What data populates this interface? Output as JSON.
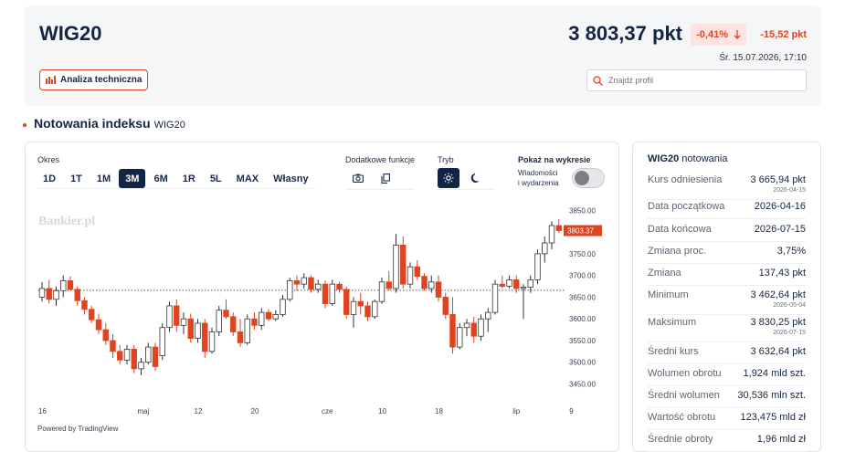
{
  "header": {
    "title": "WIG20",
    "price": "3 803,37 pkt",
    "change_pct": "-0,41%",
    "change_abs": "-15,52 pkt",
    "date": "Śr. 15.07.2026, 17:10",
    "ta_button": "Analiza techniczna",
    "search_placeholder": "Znajdź profil"
  },
  "section": {
    "title": "Notowania indeksu",
    "subtitle": "WIG20"
  },
  "controls": {
    "period_label": "Okres",
    "periods": [
      "1D",
      "1T",
      "1M",
      "3M",
      "6M",
      "1R",
      "5L",
      "MAX",
      "Własny"
    ],
    "active_period": "3M",
    "extra_label": "Dodatkowe funkcje",
    "mode_label": "Tryb",
    "show_label": "Pokaż na wykresie",
    "news_label_1": "Wiadomości",
    "news_label_2": "i wydarzenia"
  },
  "chart_data": {
    "type": "candlestick",
    "watermark": "Bankier.pl",
    "powered_by": "Powered by TradingView",
    "up_color": "#ffffff",
    "down_color": "#e0431f",
    "last_value_label": "3803.37",
    "reference_level": 3665.94,
    "ylim": [
      3430,
      3855
    ],
    "y_ticks": [
      "3850.00",
      "3800.00",
      "3750.00",
      "3700.00",
      "3650.00",
      "3600.00",
      "3550.00",
      "3500.00",
      "3450.00"
    ],
    "y_tick_values": [
      3850,
      3800,
      3750,
      3700,
      3650,
      3600,
      3550,
      3500,
      3450
    ],
    "x_ticks": [
      "16",
      "maj",
      "12",
      "20",
      "cze",
      "10",
      "18",
      "lip",
      "9"
    ],
    "x_tick_index": [
      0,
      14,
      22,
      30,
      40,
      48,
      56,
      67,
      75
    ],
    "candles": [
      [
        3650,
        3685,
        3640,
        3670
      ],
      [
        3670,
        3690,
        3635,
        3645
      ],
      [
        3645,
        3675,
        3630,
        3665
      ],
      [
        3665,
        3700,
        3650,
        3688
      ],
      [
        3688,
        3698,
        3665,
        3668
      ],
      [
        3668,
        3675,
        3630,
        3642
      ],
      [
        3642,
        3650,
        3610,
        3622
      ],
      [
        3622,
        3630,
        3590,
        3598
      ],
      [
        3598,
        3612,
        3565,
        3575
      ],
      [
        3575,
        3590,
        3540,
        3550
      ],
      [
        3550,
        3565,
        3510,
        3525
      ],
      [
        3525,
        3540,
        3495,
        3505
      ],
      [
        3505,
        3540,
        3495,
        3530
      ],
      [
        3530,
        3540,
        3475,
        3485
      ],
      [
        3485,
        3510,
        3470,
        3500
      ],
      [
        3500,
        3545,
        3495,
        3535
      ],
      [
        3535,
        3545,
        3480,
        3490
      ],
      [
        3515,
        3590,
        3505,
        3580
      ],
      [
        3580,
        3640,
        3570,
        3630
      ],
      [
        3630,
        3645,
        3570,
        3585
      ],
      [
        3585,
        3615,
        3565,
        3600
      ],
      [
        3600,
        3612,
        3545,
        3555
      ],
      [
        3555,
        3600,
        3545,
        3590
      ],
      [
        3590,
        3600,
        3510,
        3525
      ],
      [
        3525,
        3580,
        3520,
        3570
      ],
      [
        3570,
        3630,
        3560,
        3620
      ],
      [
        3620,
        3645,
        3600,
        3605
      ],
      [
        3605,
        3615,
        3560,
        3570
      ],
      [
        3570,
        3600,
        3535,
        3545
      ],
      [
        3545,
        3610,
        3540,
        3600
      ],
      [
        3600,
        3615,
        3575,
        3585
      ],
      [
        3585,
        3625,
        3575,
        3615
      ],
      [
        3615,
        3622,
        3595,
        3600
      ],
      [
        3600,
        3620,
        3595,
        3610
      ],
      [
        3610,
        3655,
        3605,
        3645
      ],
      [
        3645,
        3695,
        3640,
        3688
      ],
      [
        3688,
        3700,
        3665,
        3680
      ],
      [
        3680,
        3705,
        3670,
        3695
      ],
      [
        3695,
        3700,
        3660,
        3668
      ],
      [
        3668,
        3690,
        3660,
        3680
      ],
      [
        3680,
        3688,
        3625,
        3635
      ],
      [
        3635,
        3690,
        3630,
        3680
      ],
      [
        3680,
        3685,
        3660,
        3668
      ],
      [
        3668,
        3675,
        3600,
        3610
      ],
      [
        3610,
        3650,
        3580,
        3640
      ],
      [
        3640,
        3660,
        3610,
        3630
      ],
      [
        3630,
        3640,
        3595,
        3605
      ],
      [
        3605,
        3645,
        3600,
        3640
      ],
      [
        3640,
        3695,
        3635,
        3685
      ],
      [
        3685,
        3710,
        3665,
        3670
      ],
      [
        3670,
        3795,
        3660,
        3770
      ],
      [
        3770,
        3790,
        3670,
        3680
      ],
      [
        3680,
        3730,
        3670,
        3720
      ],
      [
        3720,
        3735,
        3690,
        3698
      ],
      [
        3698,
        3705,
        3665,
        3670
      ],
      [
        3670,
        3700,
        3660,
        3685
      ],
      [
        3685,
        3700,
        3640,
        3650
      ],
      [
        3650,
        3660,
        3600,
        3610
      ],
      [
        3610,
        3650,
        3520,
        3535
      ],
      [
        3535,
        3590,
        3530,
        3580
      ],
      [
        3580,
        3600,
        3560,
        3590
      ],
      [
        3590,
        3605,
        3545,
        3560
      ],
      [
        3560,
        3610,
        3550,
        3600
      ],
      [
        3600,
        3625,
        3570,
        3615
      ],
      [
        3615,
        3690,
        3610,
        3680
      ],
      [
        3680,
        3700,
        3670,
        3675
      ],
      [
        3675,
        3700,
        3670,
        3690
      ],
      [
        3690,
        3700,
        3660,
        3670
      ],
      [
        3670,
        3680,
        3600,
        3673
      ],
      [
        3673,
        3700,
        3660,
        3690
      ],
      [
        3690,
        3760,
        3680,
        3750
      ],
      [
        3750,
        3790,
        3730,
        3775
      ],
      [
        3775,
        3825,
        3760,
        3815
      ],
      [
        3815,
        3830,
        3798,
        3803.37
      ]
    ]
  },
  "stats": {
    "head_bold": "WIG20",
    "head_rest": "notowania",
    "rows": [
      {
        "k": "Kurs odniesienia",
        "v": "3 665,94 pkt",
        "s": "2026-04-15"
      },
      {
        "k": "Data początkowa",
        "v": "2026-04-16",
        "s": ""
      },
      {
        "k": "Data końcowa",
        "v": "2026-07-15",
        "s": ""
      },
      {
        "k": "Zmiana proc.",
        "v": "3,75%",
        "s": ""
      },
      {
        "k": "Zmiana",
        "v": "137,43 pkt",
        "s": ""
      },
      {
        "k": "Minimum",
        "v": "3 462,64 pkt",
        "s": "2026-05-04"
      },
      {
        "k": "Maksimum",
        "v": "3 830,25 pkt",
        "s": "2026-07-15"
      },
      {
        "k": "Średni kurs",
        "v": "3 632,64 pkt",
        "s": ""
      },
      {
        "k": "Wolumen obrotu",
        "v": "1,924 mld szt.",
        "s": ""
      },
      {
        "k": "Średni wolumen",
        "v": "30,536 mln szt.",
        "s": ""
      },
      {
        "k": "Wartość obrotu",
        "v": "123,475 mld zł",
        "s": ""
      },
      {
        "k": "Średnie obroty",
        "v": "1,96 mld zł",
        "s": ""
      }
    ]
  }
}
